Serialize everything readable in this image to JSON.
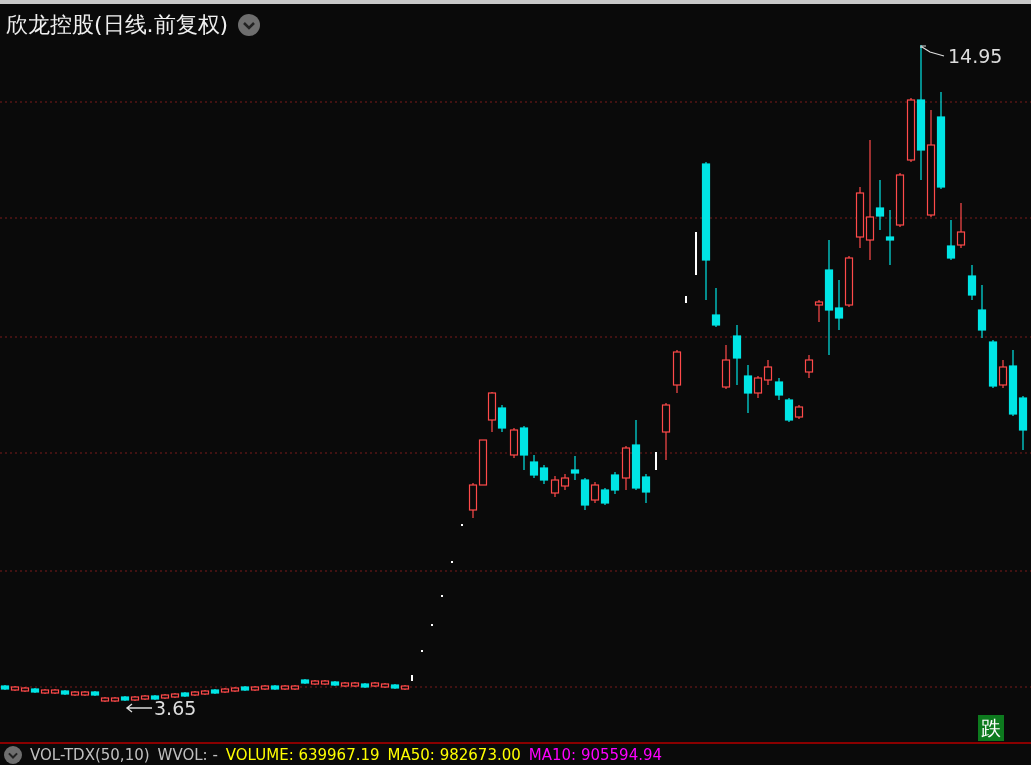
{
  "title": "欣龙控股(日线.前复权)",
  "chart": {
    "max_label": "14.95",
    "min_label": "3.65",
    "badge": "跌"
  },
  "indicator_bar": {
    "name": "VOL-TDX(50,10)",
    "items": [
      {
        "label": "WVOL: -",
        "color": "#c0c0c0"
      },
      {
        "label": "VOLUME: 639967.19",
        "color": "#ffff00"
      },
      {
        "label": "MA50: 982673.00",
        "color": "#ffff00"
      },
      {
        "label": "MA10: 905594.94",
        "color": "#ff00ff"
      }
    ]
  }
}
